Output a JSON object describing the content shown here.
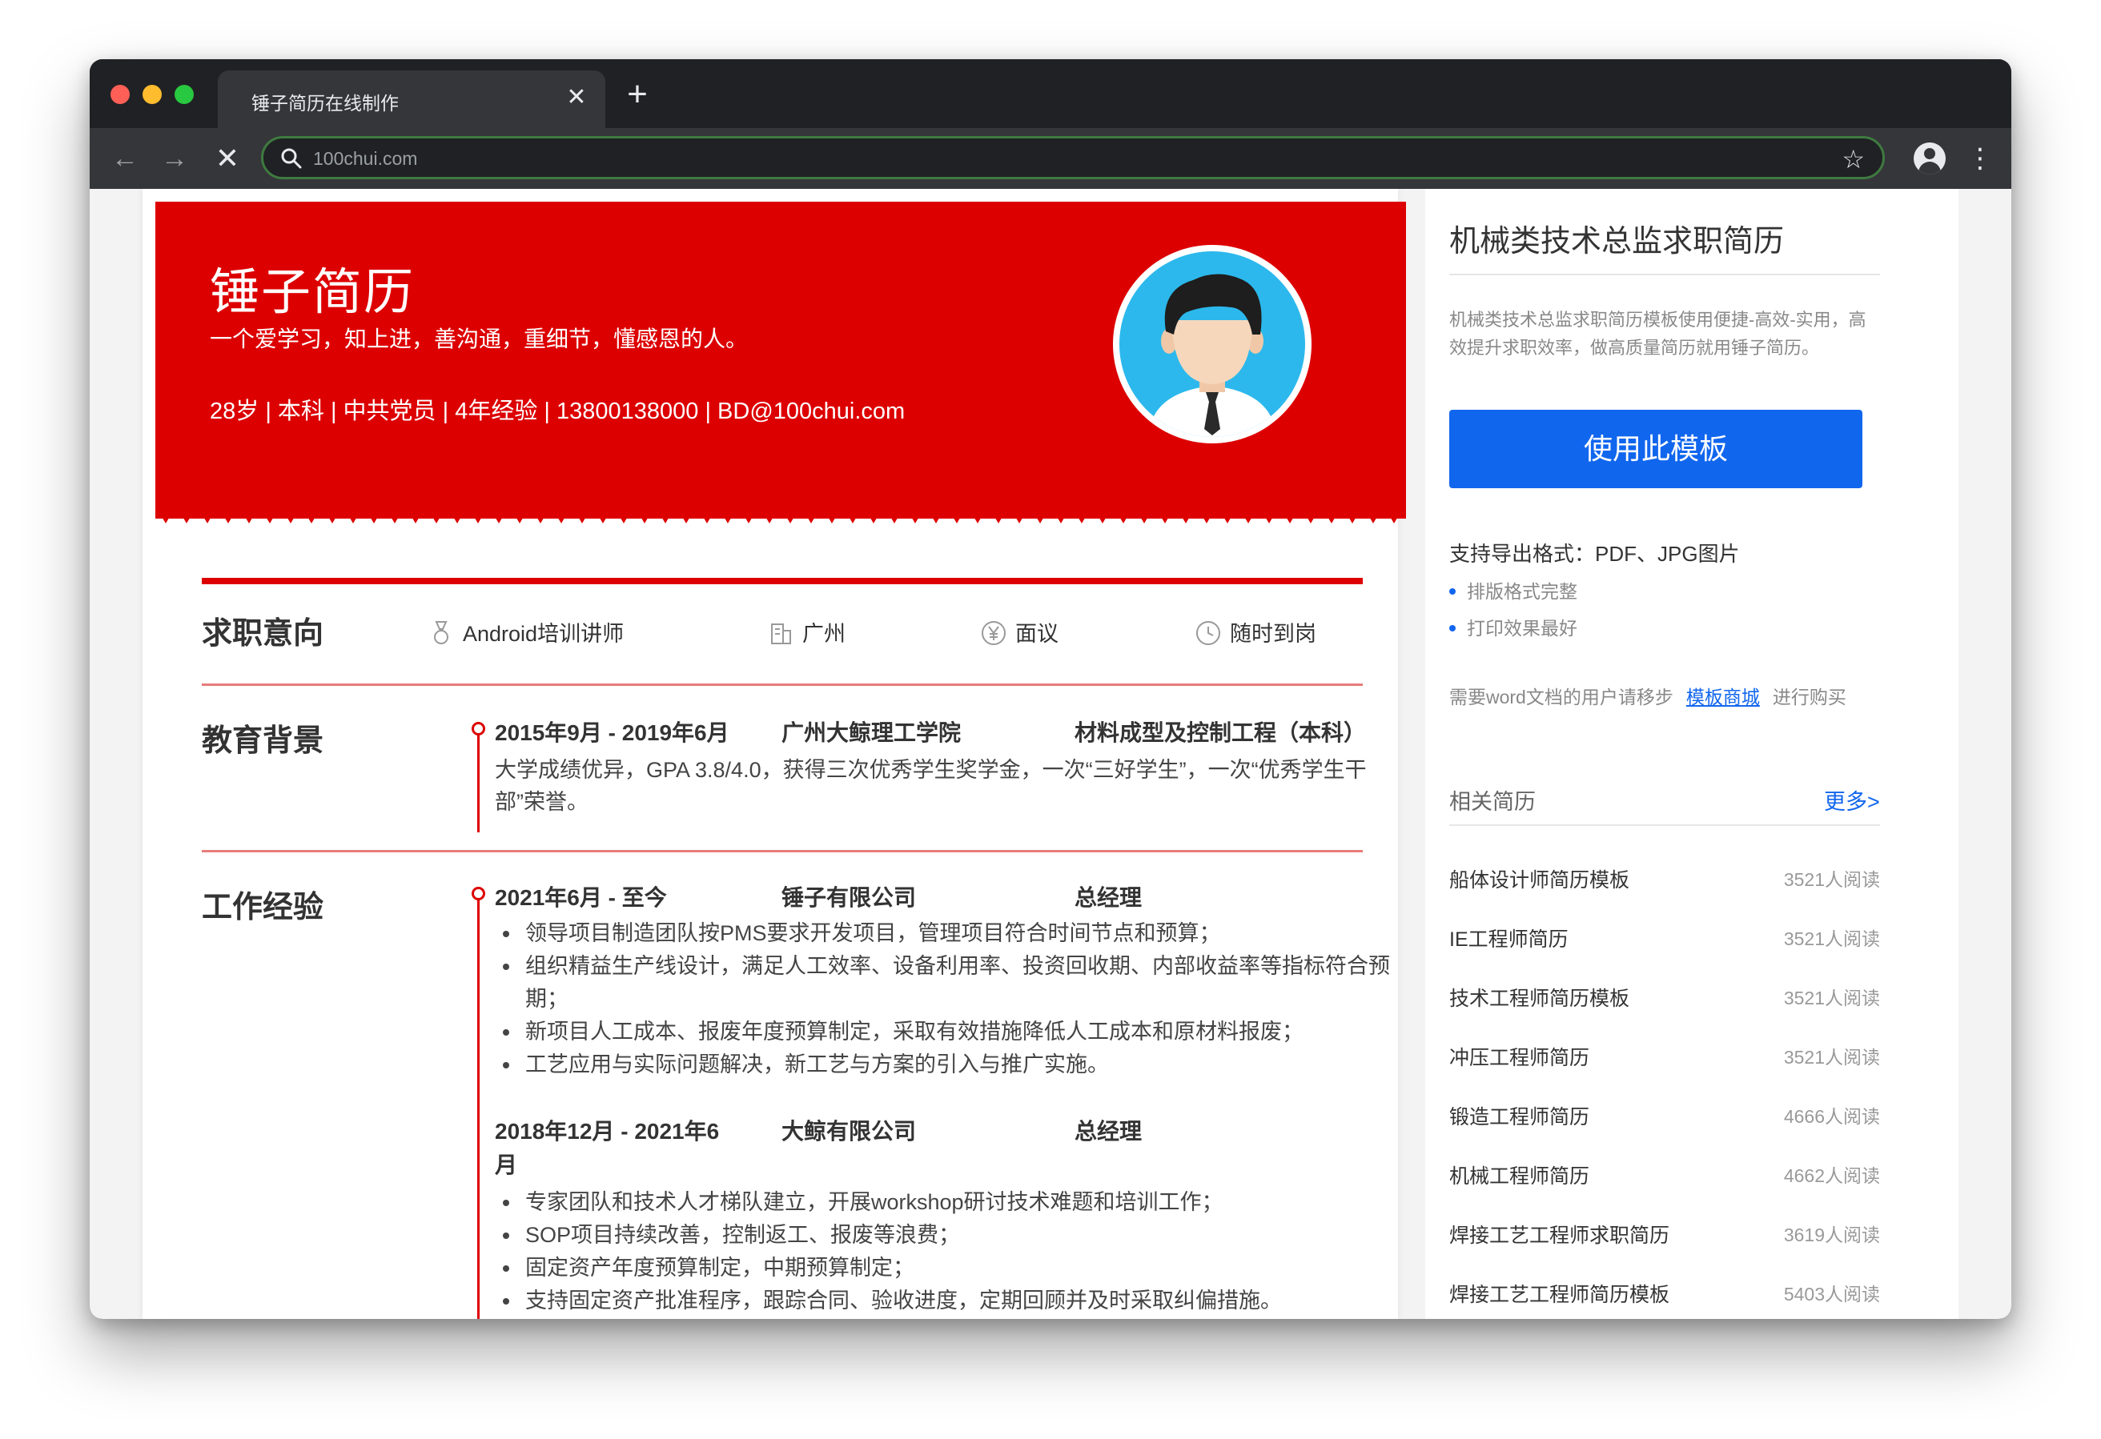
{
  "browser": {
    "tab_title": "锤子简历在线制作",
    "tab_close": "✕",
    "new_tab": "+",
    "url": "100chui.com",
    "back": "←",
    "forward": "→",
    "stop": "✕",
    "star": "☆",
    "menu": "⋮"
  },
  "resume": {
    "name": "锤子简历",
    "motto": "一个爱学习，知上进，善沟通，重细节，懂感恩的人。",
    "info": "28岁 | 本科 | 中共党员 | 4年经验 | 13800138000 | BD@100chui.com",
    "sections": {
      "intent": "求职意向",
      "education": "教育背景",
      "work": "工作经验"
    },
    "intent": {
      "position": "Android培训讲师",
      "city": "广州",
      "salary": "面议",
      "availability": "随时到岗"
    },
    "education": {
      "period": "2015年9月 - 2019年6月",
      "school": "广州大鲸理工学院",
      "major": "材料成型及控制工程（本科）",
      "desc": "大学成绩优异，GPA 3.8/4.0，获得三次优秀学生奖学金，一次“三好学生”，一次“优秀学生干部”荣誉。"
    },
    "jobs": [
      {
        "period": "2021年6月 - 至今",
        "company": "锤子有限公司",
        "role": "总经理",
        "bullets": [
          "领导项目制造团队按PMS要求开发项目，管理项目符合时间节点和预算；",
          "组织精益生产线设计，满足人工效率、设备利用率、投资回收期、内部收益率等指标符合预期；",
          "新项目人工成本、报废年度预算制定，采取有效措施降低人工成本和原材料报废；",
          "工艺应用与实际问题解决，新工艺与方案的引入与推广实施。"
        ]
      },
      {
        "period_line1": "2018年12月 - 2021年6",
        "period_line2": "月",
        "company": "大鲸有限公司",
        "role": "总经理",
        "bullets": [
          "专家团队和技术人才梯队建立，开展workshop研讨技术难题和培训工作；",
          "SOP项目持续改善，控制返工、报废等浪费；",
          "固定资产年度预算制定，中期预算制定；",
          "支持固定资产批准程序，跟踪合同、验收进度，定期回顾并及时采取纠偏措施。"
        ]
      }
    ]
  },
  "sidebar": {
    "title": "机械类技术总监求职简历",
    "desc": "机械类技术总监求职简历模板使用便捷-高效-实用，高效提升求职效率，做高质量简历就用锤子简历。",
    "button": "使用此模板",
    "formats": "支持导出格式：PDF、JPG图片",
    "features": [
      "排版格式完整",
      "打印效果最好"
    ],
    "note_before": "需要word文档的用户请移步",
    "note_link": "模板商城",
    "note_after": "进行购买",
    "related_title": "相关简历",
    "more": "更多>",
    "related": [
      {
        "name": "船体设计师简历模板",
        "count": "3521人阅读"
      },
      {
        "name": "IE工程师简历",
        "count": "3521人阅读"
      },
      {
        "name": "技术工程师简历模板",
        "count": "3521人阅读"
      },
      {
        "name": "冲压工程师简历",
        "count": "3521人阅读"
      },
      {
        "name": "锻造工程师简历",
        "count": "4666人阅读"
      },
      {
        "name": "机械工程师简历",
        "count": "4662人阅读"
      },
      {
        "name": "焊接工艺工程师求职简历",
        "count": "3619人阅读"
      },
      {
        "name": "焊接工艺工程师简历模板",
        "count": "5403人阅读"
      }
    ]
  },
  "colors": {
    "brand_red": "#dd0000",
    "accent_blue": "#1166ee",
    "chrome_dark": "#202124"
  }
}
